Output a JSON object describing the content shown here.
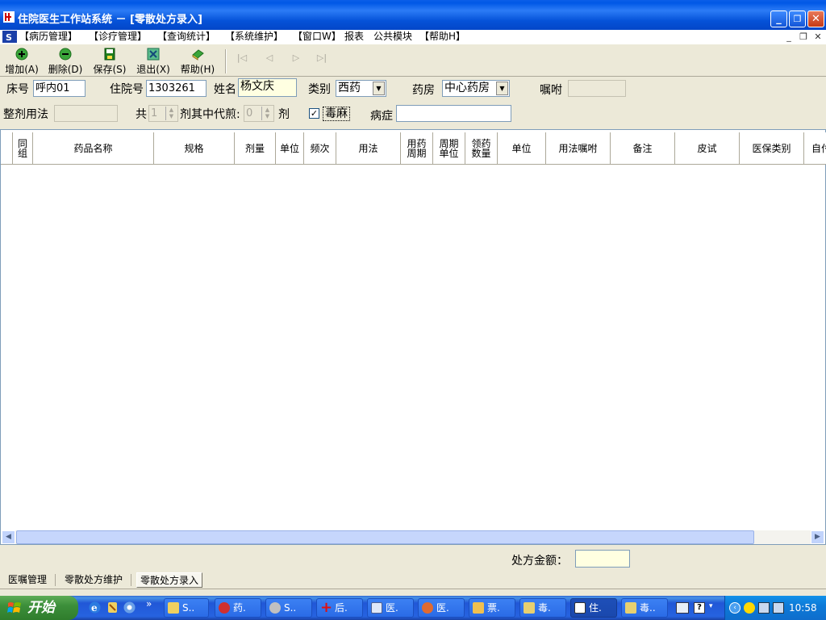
{
  "window": {
    "title": "住院医生工作站系统 － [零散处方录入]",
    "controls": {
      "minimize": "_",
      "restore": "❐",
      "close": "✕"
    }
  },
  "menu": {
    "items": [
      "【病历管理】",
      "【诊疗管理】",
      "【查询统计】",
      "【系统维护】",
      "【窗口W】",
      "报表",
      "公共模块",
      "【帮助H】"
    ],
    "mdi": {
      "minimize": "_",
      "restore": "❐",
      "close": "✕"
    }
  },
  "toolbar": {
    "add_label": "增加(A)",
    "delete_label": "删除(D)",
    "save_label": "保存(S)",
    "exit_label": "退出(X)",
    "help_label": "帮助(H)",
    "nav": {
      "first": "|◁",
      "prev": "◁",
      "next": "▷",
      "last": "▷|"
    }
  },
  "form": {
    "bed_label": "床号",
    "bed_value": "呼内01",
    "admission_label": "住院号",
    "admission_value": "1303261",
    "name_label": "姓名",
    "name_value": "杨文庆",
    "category_label": "类别",
    "category_value": "西药",
    "pharmacy_label": "药房",
    "pharmacy_value": "中心药房",
    "instruction_label": "嘱咐",
    "instruction_value": "",
    "dosage_method_label": "整剂用法",
    "dosage_method_value": "",
    "total_label": "共",
    "total_value": "1",
    "decoct_label": "剂其中代煎:",
    "decoct_value": "0",
    "dose_unit_label": "剂",
    "narcotic_checked": true,
    "narcotic_label": "毒麻",
    "disease_label": "病症",
    "disease_value": ""
  },
  "grid": {
    "columns": [
      "同\n组",
      "药品名称",
      "规格",
      "剂量",
      "单位",
      "频次",
      "用法",
      "用药\n周期",
      "周期\n单位",
      "领药\n数量",
      "单位",
      "用法嘱咐",
      "备注",
      "皮试",
      "医保类别",
      "自付"
    ],
    "rows": []
  },
  "footer": {
    "amount_label": "处方金额：",
    "amount_value": "",
    "tabs": [
      "医嘱管理",
      "零散处方维护",
      "零散处方录入"
    ],
    "active_tab": "零散处方录入"
  },
  "taskbar": {
    "start_label": "开始",
    "tasks": [
      "S..",
      "药.",
      "S..",
      "后.",
      "医.",
      "医.",
      "票.",
      "毒.",
      "住.",
      "毒.."
    ],
    "active_task": "住.",
    "clock": "10:58"
  },
  "colors": {
    "title_blue": "#0058e6",
    "form_bg": "#ece9d8",
    "yellow_field": "#ffffe1",
    "taskbar_blue": "#2663e0",
    "start_green": "#3c8f3a"
  }
}
